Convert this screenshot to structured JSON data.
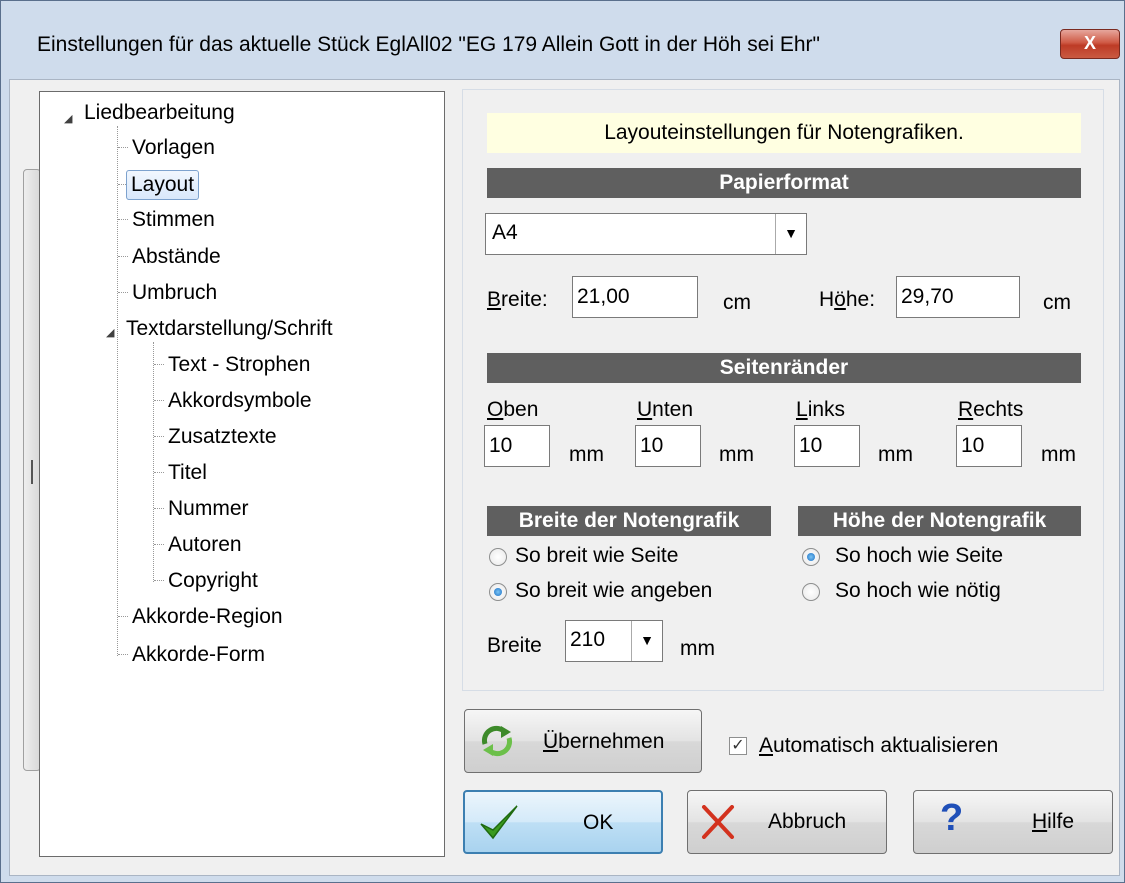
{
  "window": {
    "title": "Einstellungen für das aktuelle Stück EglAll02  \"EG 179 Allein Gott in der Höh sei Ehr\"",
    "close_label": "X"
  },
  "tree": {
    "root": "Liedbearbeitung",
    "items_level1_a": [
      "Vorlagen",
      "Layout",
      "Stimmen",
      "Abstände",
      "Umbruch"
    ],
    "group2": "Textdarstellung/Schrift",
    "items_level2": [
      "Text - Strophen",
      "Akkordsymbole",
      "Zusatztexte",
      "Titel",
      "Nummer",
      "Autoren",
      "Copyright"
    ],
    "items_level1_b": [
      "Akkorde-Region",
      "Akkorde-Form"
    ],
    "selected": "Layout"
  },
  "panel": {
    "info": "Layouteinstellungen für Notengrafiken.",
    "paper_section": "Papierformat",
    "paper_format": "A4",
    "breite_label": "Breite:",
    "breite_value": "21,00",
    "breite_unit": "cm",
    "hoehe_label": "Höhe:",
    "hoehe_value": "29,70",
    "hoehe_unit": "cm",
    "margins_section": "Seitenränder",
    "margins": [
      {
        "label": "Oben",
        "value": "10",
        "unit": "mm"
      },
      {
        "label": "Unten",
        "value": "10",
        "unit": "mm"
      },
      {
        "label": "Links",
        "value": "10",
        "unit": "mm"
      },
      {
        "label": "Rechts",
        "value": "10",
        "unit": "mm"
      }
    ],
    "width_section": "Breite der Notengrafik",
    "width_options": [
      "So breit wie Seite",
      "So breit wie angeben"
    ],
    "width_selected": 1,
    "height_section": "Höhe der Notengrafik",
    "height_options": [
      "So hoch wie Seite",
      "So hoch wie nötig"
    ],
    "height_selected": 0,
    "breite_combo_label": "Breite",
    "breite_combo_value": "210",
    "breite_combo_unit": "mm"
  },
  "buttons": {
    "apply": "Übernehmen",
    "auto_update": "Automatisch aktualisieren",
    "auto_update_checked": true,
    "ok": "OK",
    "cancel": "Abbruch",
    "help": "Hilfe"
  }
}
